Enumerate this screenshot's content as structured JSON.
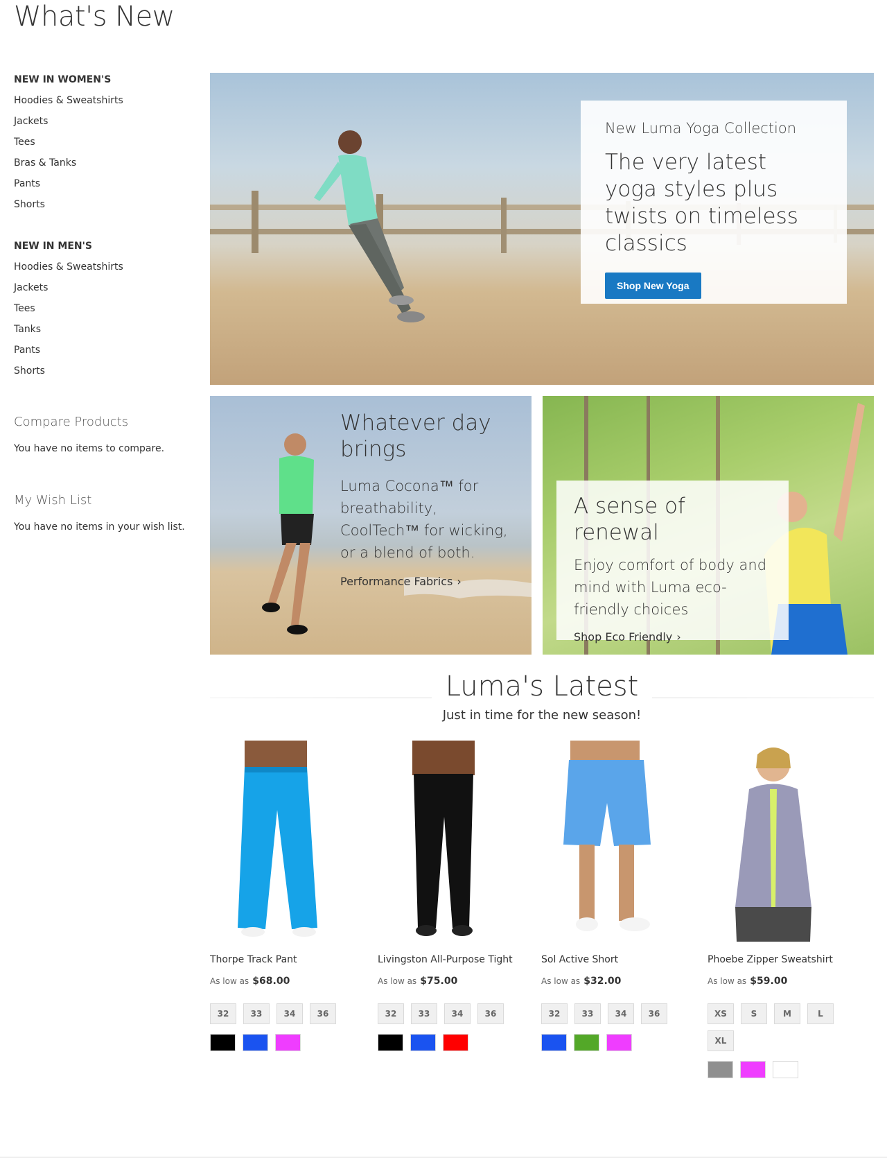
{
  "page": {
    "title": "What's New"
  },
  "sidebar": {
    "women": {
      "heading": "NEW IN WOMEN'S",
      "items": [
        "Hoodies & Sweatshirts",
        "Jackets",
        "Tees",
        "Bras & Tanks",
        "Pants",
        "Shorts"
      ]
    },
    "men": {
      "heading": "NEW IN MEN'S",
      "items": [
        "Hoodies & Sweatshirts",
        "Jackets",
        "Tees",
        "Tanks",
        "Pants",
        "Shorts"
      ]
    },
    "compare": {
      "title": "Compare Products",
      "empty": "You have no items to compare."
    },
    "wishlist": {
      "title": "My Wish List",
      "empty": "You have no items in your wish list."
    }
  },
  "hero": {
    "eyebrow": "New Luma Yoga Collection",
    "headline": "The very latest yoga styles plus twists on timeless classics",
    "button": "Shop New Yoga"
  },
  "promo1": {
    "title": "Whatever day brings",
    "body": "Luma Cocona™ for breathability, CoolTech™ for wicking, or a blend of both.",
    "link": "Performance Fabrics"
  },
  "promo2": {
    "title": "A sense of renewal",
    "body": "Enjoy comfort of body and mind with Luma eco-friendly choices",
    "link": "Shop Eco Friendly"
  },
  "latest": {
    "title": "Luma's Latest",
    "subtitle": "Just in time for the new season!"
  },
  "products": [
    {
      "name": "Thorpe Track Pant",
      "as_low_as": "As low as",
      "price": "$68.00",
      "sizes": [
        "32",
        "33",
        "34",
        "36"
      ],
      "colors": [
        "#000000",
        "#1a53f0",
        "#ef3dff"
      ]
    },
    {
      "name": "Livingston All-Purpose Tight",
      "as_low_as": "As low as",
      "price": "$75.00",
      "sizes": [
        "32",
        "33",
        "34",
        "36"
      ],
      "colors": [
        "#000000",
        "#1a53f0",
        "#ff0000"
      ]
    },
    {
      "name": "Sol Active Short",
      "as_low_as": "As low as",
      "price": "$32.00",
      "sizes": [
        "32",
        "33",
        "34",
        "36"
      ],
      "colors": [
        "#1a53f0",
        "#53a828",
        "#ef3dff"
      ]
    },
    {
      "name": "Phoebe Zipper Sweatshirt",
      "as_low_as": "As low as",
      "price": "$59.00",
      "sizes": [
        "XS",
        "S",
        "M",
        "L",
        "XL"
      ],
      "colors": [
        "#8f8f8f",
        "#ef3dff",
        "#ffffff"
      ]
    }
  ]
}
